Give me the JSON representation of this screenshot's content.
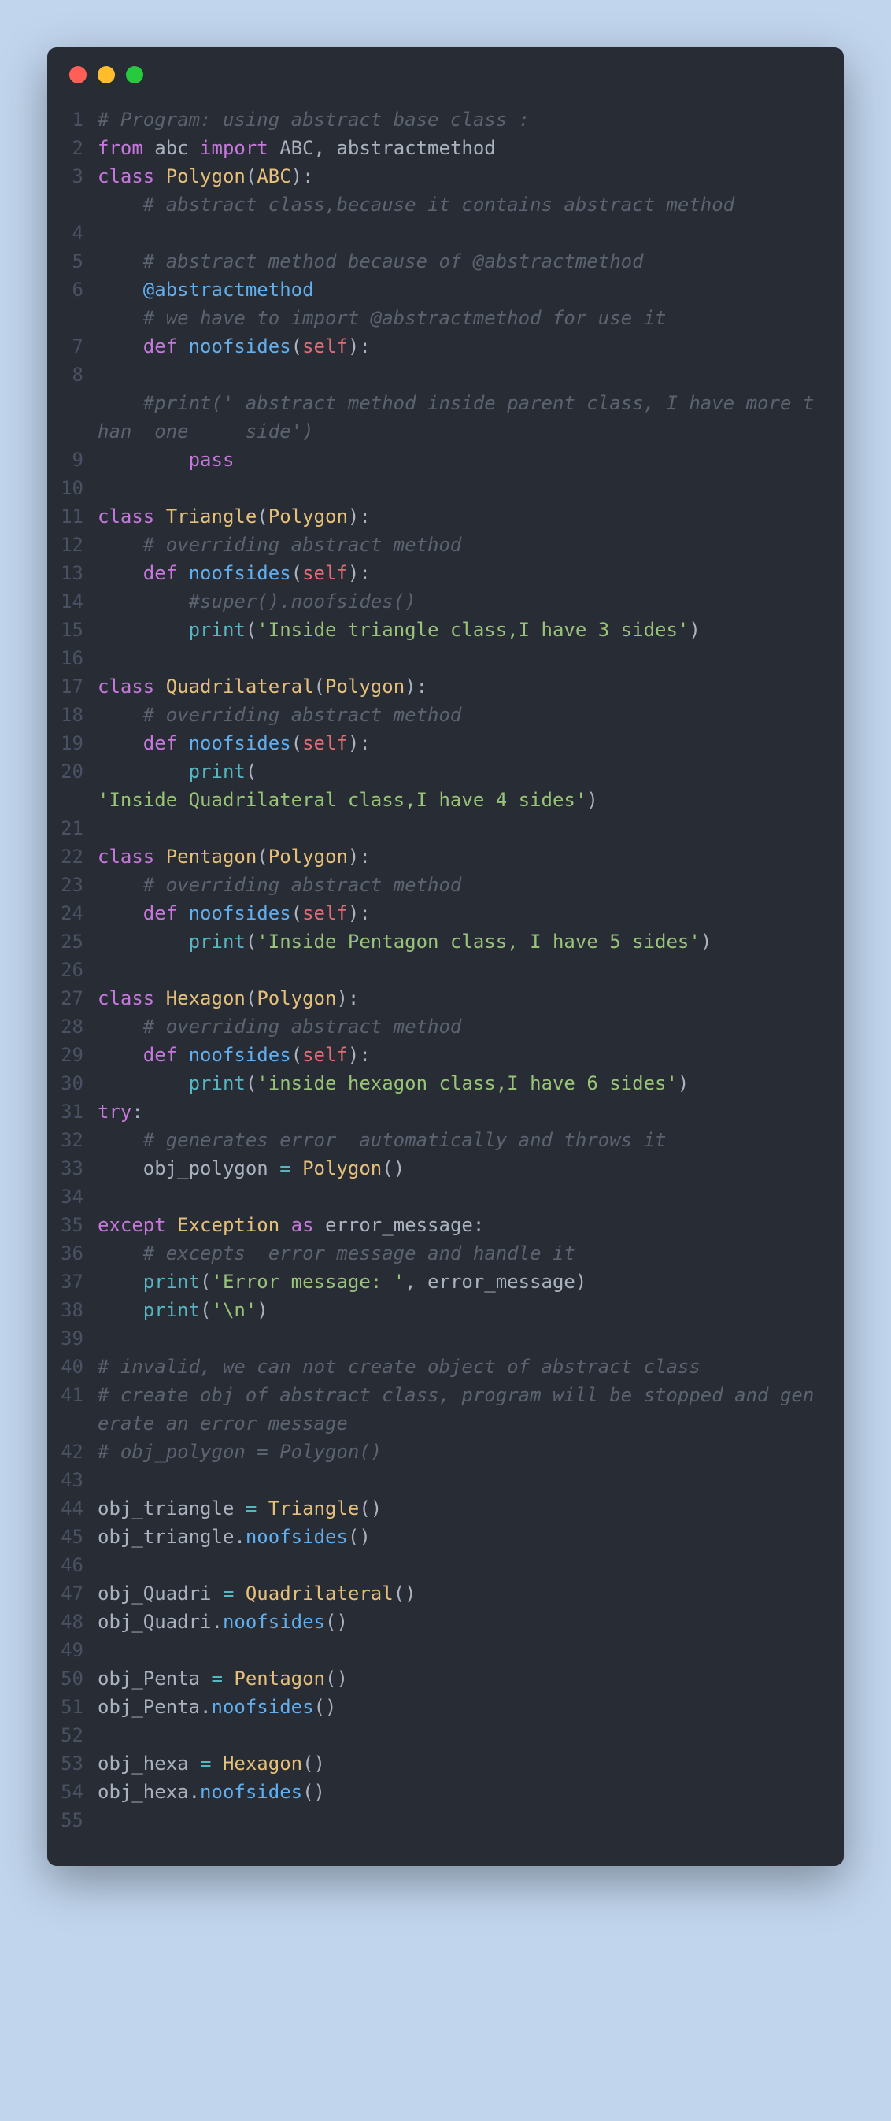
{
  "window": {
    "title": "code-editor"
  },
  "lines": [
    {
      "n": "1",
      "parts": [
        {
          "t": "# Program: using abstract base class :",
          "c": "c-comment"
        }
      ]
    },
    {
      "n": "2",
      "parts": [
        {
          "t": "from",
          "c": "c-keyword"
        },
        {
          "t": " abc ",
          "c": "c-punct"
        },
        {
          "t": "import",
          "c": "c-keyword"
        },
        {
          "t": " ABC, abstractmethod",
          "c": "c-punct"
        }
      ]
    },
    {
      "n": "3",
      "parts": [
        {
          "t": "class",
          "c": "c-keyword"
        },
        {
          "t": " ",
          "c": ""
        },
        {
          "t": "Polygon",
          "c": "c-class"
        },
        {
          "t": "(",
          "c": "c-punct"
        },
        {
          "t": "ABC",
          "c": "c-class"
        },
        {
          "t": "):",
          "c": "c-punct"
        }
      ]
    },
    {
      "n": "",
      "parts": [
        {
          "t": "    ",
          "c": ""
        },
        {
          "t": "# abstract class,because it contains abstract method",
          "c": "c-comment"
        }
      ]
    },
    {
      "n": "4",
      "parts": [
        {
          "t": "",
          "c": ""
        }
      ]
    },
    {
      "n": "5",
      "parts": [
        {
          "t": "    ",
          "c": ""
        },
        {
          "t": "# abstract method because of @abstractmethod",
          "c": "c-comment"
        }
      ]
    },
    {
      "n": "6",
      "parts": [
        {
          "t": "    ",
          "c": ""
        },
        {
          "t": "@abstractmethod",
          "c": "c-decorator"
        }
      ]
    },
    {
      "n": "",
      "parts": [
        {
          "t": "    ",
          "c": ""
        },
        {
          "t": "# we have to import @abstractmethod for use it",
          "c": "c-comment"
        }
      ]
    },
    {
      "n": "7",
      "parts": [
        {
          "t": "    ",
          "c": ""
        },
        {
          "t": "def",
          "c": "c-keyword"
        },
        {
          "t": " ",
          "c": ""
        },
        {
          "t": "noofsides",
          "c": "c-func"
        },
        {
          "t": "(",
          "c": "c-punct"
        },
        {
          "t": "self",
          "c": "c-self"
        },
        {
          "t": "):",
          "c": "c-punct"
        }
      ]
    },
    {
      "n": "8",
      "parts": [
        {
          "t": "",
          "c": ""
        }
      ]
    },
    {
      "n": "",
      "parts": [
        {
          "t": "    ",
          "c": ""
        },
        {
          "t": "#print(' abstract method inside parent class, I have more than  one     side')",
          "c": "c-comment"
        }
      ]
    },
    {
      "n": "9",
      "parts": [
        {
          "t": "        ",
          "c": ""
        },
        {
          "t": "pass",
          "c": "c-keyword"
        }
      ]
    },
    {
      "n": "10",
      "parts": [
        {
          "t": "",
          "c": ""
        }
      ]
    },
    {
      "n": "11",
      "parts": [
        {
          "t": "class",
          "c": "c-keyword"
        },
        {
          "t": " ",
          "c": ""
        },
        {
          "t": "Triangle",
          "c": "c-class"
        },
        {
          "t": "(",
          "c": "c-punct"
        },
        {
          "t": "Polygon",
          "c": "c-class"
        },
        {
          "t": "):",
          "c": "c-punct"
        }
      ]
    },
    {
      "n": "12",
      "parts": [
        {
          "t": "    ",
          "c": ""
        },
        {
          "t": "# overriding abstract method",
          "c": "c-comment"
        }
      ]
    },
    {
      "n": "13",
      "parts": [
        {
          "t": "    ",
          "c": ""
        },
        {
          "t": "def",
          "c": "c-keyword"
        },
        {
          "t": " ",
          "c": ""
        },
        {
          "t": "noofsides",
          "c": "c-func"
        },
        {
          "t": "(",
          "c": "c-punct"
        },
        {
          "t": "self",
          "c": "c-self"
        },
        {
          "t": "):",
          "c": "c-punct"
        }
      ]
    },
    {
      "n": "14",
      "parts": [
        {
          "t": "        ",
          "c": ""
        },
        {
          "t": "#super().noofsides()",
          "c": "c-comment"
        }
      ]
    },
    {
      "n": "15",
      "parts": [
        {
          "t": "        ",
          "c": ""
        },
        {
          "t": "print",
          "c": "c-builtin"
        },
        {
          "t": "(",
          "c": "c-punct"
        },
        {
          "t": "'Inside triangle class,I have 3 sides'",
          "c": "c-string"
        },
        {
          "t": ")",
          "c": "c-punct"
        }
      ]
    },
    {
      "n": "16",
      "parts": [
        {
          "t": "",
          "c": ""
        }
      ]
    },
    {
      "n": "17",
      "parts": [
        {
          "t": "class",
          "c": "c-keyword"
        },
        {
          "t": " ",
          "c": ""
        },
        {
          "t": "Quadrilateral",
          "c": "c-class"
        },
        {
          "t": "(",
          "c": "c-punct"
        },
        {
          "t": "Polygon",
          "c": "c-class"
        },
        {
          "t": "):",
          "c": "c-punct"
        }
      ]
    },
    {
      "n": "18",
      "parts": [
        {
          "t": "    ",
          "c": ""
        },
        {
          "t": "# overriding abstract method",
          "c": "c-comment"
        }
      ]
    },
    {
      "n": "19",
      "parts": [
        {
          "t": "    ",
          "c": ""
        },
        {
          "t": "def",
          "c": "c-keyword"
        },
        {
          "t": " ",
          "c": ""
        },
        {
          "t": "noofsides",
          "c": "c-func"
        },
        {
          "t": "(",
          "c": "c-punct"
        },
        {
          "t": "self",
          "c": "c-self"
        },
        {
          "t": "):",
          "c": "c-punct"
        }
      ]
    },
    {
      "n": "20",
      "parts": [
        {
          "t": "        ",
          "c": ""
        },
        {
          "t": "print",
          "c": "c-builtin"
        },
        {
          "t": "(",
          "c": "c-punct"
        }
      ]
    },
    {
      "n": "",
      "parts": [
        {
          "t": "'Inside Quadrilateral class,I have 4 sides'",
          "c": "c-string"
        },
        {
          "t": ")",
          "c": "c-punct"
        }
      ]
    },
    {
      "n": "21",
      "parts": [
        {
          "t": "",
          "c": ""
        }
      ]
    },
    {
      "n": "22",
      "parts": [
        {
          "t": "class",
          "c": "c-keyword"
        },
        {
          "t": " ",
          "c": ""
        },
        {
          "t": "Pentagon",
          "c": "c-class"
        },
        {
          "t": "(",
          "c": "c-punct"
        },
        {
          "t": "Polygon",
          "c": "c-class"
        },
        {
          "t": "):",
          "c": "c-punct"
        }
      ]
    },
    {
      "n": "23",
      "parts": [
        {
          "t": "    ",
          "c": ""
        },
        {
          "t": "# overriding abstract method",
          "c": "c-comment"
        }
      ]
    },
    {
      "n": "24",
      "parts": [
        {
          "t": "    ",
          "c": ""
        },
        {
          "t": "def",
          "c": "c-keyword"
        },
        {
          "t": " ",
          "c": ""
        },
        {
          "t": "noofsides",
          "c": "c-func"
        },
        {
          "t": "(",
          "c": "c-punct"
        },
        {
          "t": "self",
          "c": "c-self"
        },
        {
          "t": "):",
          "c": "c-punct"
        }
      ]
    },
    {
      "n": "25",
      "parts": [
        {
          "t": "        ",
          "c": ""
        },
        {
          "t": "print",
          "c": "c-builtin"
        },
        {
          "t": "(",
          "c": "c-punct"
        },
        {
          "t": "'Inside Pentagon class, I have 5 sides'",
          "c": "c-string"
        },
        {
          "t": ")",
          "c": "c-punct"
        }
      ]
    },
    {
      "n": "26",
      "parts": [
        {
          "t": "",
          "c": ""
        }
      ]
    },
    {
      "n": "27",
      "parts": [
        {
          "t": "class",
          "c": "c-keyword"
        },
        {
          "t": " ",
          "c": ""
        },
        {
          "t": "Hexagon",
          "c": "c-class"
        },
        {
          "t": "(",
          "c": "c-punct"
        },
        {
          "t": "Polygon",
          "c": "c-class"
        },
        {
          "t": "):",
          "c": "c-punct"
        }
      ]
    },
    {
      "n": "28",
      "parts": [
        {
          "t": "    ",
          "c": ""
        },
        {
          "t": "# overriding abstract method",
          "c": "c-comment"
        }
      ]
    },
    {
      "n": "29",
      "parts": [
        {
          "t": "    ",
          "c": ""
        },
        {
          "t": "def",
          "c": "c-keyword"
        },
        {
          "t": " ",
          "c": ""
        },
        {
          "t": "noofsides",
          "c": "c-func"
        },
        {
          "t": "(",
          "c": "c-punct"
        },
        {
          "t": "self",
          "c": "c-self"
        },
        {
          "t": "):",
          "c": "c-punct"
        }
      ]
    },
    {
      "n": "30",
      "parts": [
        {
          "t": "        ",
          "c": ""
        },
        {
          "t": "print",
          "c": "c-builtin"
        },
        {
          "t": "(",
          "c": "c-punct"
        },
        {
          "t": "'inside hexagon class,I have 6 sides'",
          "c": "c-string"
        },
        {
          "t": ")",
          "c": "c-punct"
        }
      ]
    },
    {
      "n": "31",
      "parts": [
        {
          "t": "try",
          "c": "c-keyword"
        },
        {
          "t": ":",
          "c": "c-punct"
        }
      ]
    },
    {
      "n": "32",
      "parts": [
        {
          "t": "    ",
          "c": ""
        },
        {
          "t": "# generates error  automatically and throws it",
          "c": "c-comment"
        }
      ]
    },
    {
      "n": "33",
      "parts": [
        {
          "t": "    obj_polygon ",
          "c": "c-punct"
        },
        {
          "t": "=",
          "c": "c-op"
        },
        {
          "t": " ",
          "c": ""
        },
        {
          "t": "Polygon",
          "c": "c-class"
        },
        {
          "t": "()",
          "c": "c-punct"
        }
      ]
    },
    {
      "n": "34",
      "parts": [
        {
          "t": "",
          "c": ""
        }
      ]
    },
    {
      "n": "35",
      "parts": [
        {
          "t": "except",
          "c": "c-keyword"
        },
        {
          "t": " ",
          "c": ""
        },
        {
          "t": "Exception",
          "c": "c-class"
        },
        {
          "t": " ",
          "c": ""
        },
        {
          "t": "as",
          "c": "c-keyword"
        },
        {
          "t": " error_message:",
          "c": "c-punct"
        }
      ]
    },
    {
      "n": "36",
      "parts": [
        {
          "t": "    ",
          "c": ""
        },
        {
          "t": "# excepts  error message and handle it",
          "c": "c-comment"
        }
      ]
    },
    {
      "n": "37",
      "parts": [
        {
          "t": "    ",
          "c": ""
        },
        {
          "t": "print",
          "c": "c-builtin"
        },
        {
          "t": "(",
          "c": "c-punct"
        },
        {
          "t": "'Error message: '",
          "c": "c-string"
        },
        {
          "t": ", error_message)",
          "c": "c-punct"
        }
      ]
    },
    {
      "n": "38",
      "parts": [
        {
          "t": "    ",
          "c": ""
        },
        {
          "t": "print",
          "c": "c-builtin"
        },
        {
          "t": "(",
          "c": "c-punct"
        },
        {
          "t": "'\\n'",
          "c": "c-string"
        },
        {
          "t": ")",
          "c": "c-punct"
        }
      ]
    },
    {
      "n": "39",
      "parts": [
        {
          "t": "",
          "c": ""
        }
      ]
    },
    {
      "n": "40",
      "parts": [
        {
          "t": "# invalid, we can not create object of abstract class",
          "c": "c-comment"
        }
      ]
    },
    {
      "n": "41",
      "parts": [
        {
          "t": "# create obj of abstract class, program will be stopped and generate an error message",
          "c": "c-comment"
        }
      ]
    },
    {
      "n": "42",
      "parts": [
        {
          "t": "# obj_polygon = Polygon()",
          "c": "c-comment"
        }
      ]
    },
    {
      "n": "43",
      "parts": [
        {
          "t": "",
          "c": ""
        }
      ]
    },
    {
      "n": "44",
      "parts": [
        {
          "t": "obj_triangle ",
          "c": "c-punct"
        },
        {
          "t": "=",
          "c": "c-op"
        },
        {
          "t": " ",
          "c": ""
        },
        {
          "t": "Triangle",
          "c": "c-class"
        },
        {
          "t": "()",
          "c": "c-punct"
        }
      ]
    },
    {
      "n": "45",
      "parts": [
        {
          "t": "obj_triangle.",
          "c": "c-punct"
        },
        {
          "t": "noofsides",
          "c": "c-func"
        },
        {
          "t": "()",
          "c": "c-punct"
        }
      ]
    },
    {
      "n": "46",
      "parts": [
        {
          "t": "",
          "c": ""
        }
      ]
    },
    {
      "n": "47",
      "parts": [
        {
          "t": "obj_Quadri ",
          "c": "c-punct"
        },
        {
          "t": "=",
          "c": "c-op"
        },
        {
          "t": " ",
          "c": ""
        },
        {
          "t": "Quadrilateral",
          "c": "c-class"
        },
        {
          "t": "()",
          "c": "c-punct"
        }
      ]
    },
    {
      "n": "48",
      "parts": [
        {
          "t": "obj_Quadri.",
          "c": "c-punct"
        },
        {
          "t": "noofsides",
          "c": "c-func"
        },
        {
          "t": "()",
          "c": "c-punct"
        }
      ]
    },
    {
      "n": "49",
      "parts": [
        {
          "t": "",
          "c": ""
        }
      ]
    },
    {
      "n": "50",
      "parts": [
        {
          "t": "obj_Penta ",
          "c": "c-punct"
        },
        {
          "t": "=",
          "c": "c-op"
        },
        {
          "t": " ",
          "c": ""
        },
        {
          "t": "Pentagon",
          "c": "c-class"
        },
        {
          "t": "()",
          "c": "c-punct"
        }
      ]
    },
    {
      "n": "51",
      "parts": [
        {
          "t": "obj_Penta.",
          "c": "c-punct"
        },
        {
          "t": "noofsides",
          "c": "c-func"
        },
        {
          "t": "()",
          "c": "c-punct"
        }
      ]
    },
    {
      "n": "52",
      "parts": [
        {
          "t": "",
          "c": ""
        }
      ]
    },
    {
      "n": "53",
      "parts": [
        {
          "t": "obj_hexa ",
          "c": "c-punct"
        },
        {
          "t": "=",
          "c": "c-op"
        },
        {
          "t": " ",
          "c": ""
        },
        {
          "t": "Hexagon",
          "c": "c-class"
        },
        {
          "t": "()",
          "c": "c-punct"
        }
      ]
    },
    {
      "n": "54",
      "parts": [
        {
          "t": "obj_hexa.",
          "c": "c-punct"
        },
        {
          "t": "noofsides",
          "c": "c-func"
        },
        {
          "t": "()",
          "c": "c-punct"
        }
      ]
    },
    {
      "n": "55",
      "parts": [
        {
          "t": "",
          "c": ""
        }
      ]
    }
  ]
}
